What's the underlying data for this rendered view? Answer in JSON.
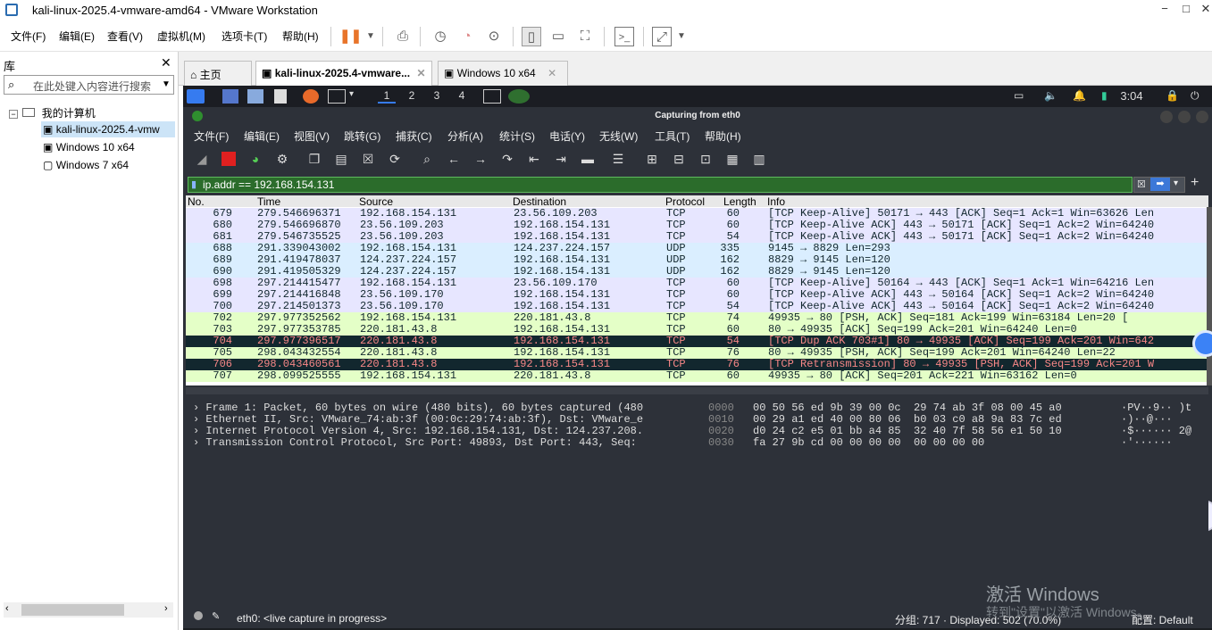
{
  "window": {
    "title": "kali-linux-2025.4-vmware-amd64 - VMware Workstation",
    "min": "−",
    "max": "□",
    "close": "✕"
  },
  "menu": [
    "文件(F)",
    "编辑(E)",
    "查看(V)",
    "虚拟机(M)",
    "选项卡(T)",
    "帮助(H)"
  ],
  "library": {
    "title": "库",
    "close": "✕",
    "search_placeholder": "在此处键入内容进行搜索",
    "root": "我的计算机",
    "vms": [
      "kali-linux-2025.4-vmw",
      "Windows 10 x64",
      "Windows 7 x64"
    ]
  },
  "tabs": [
    {
      "label": "主页"
    },
    {
      "label": "kali-linux-2025.4-vmware..."
    },
    {
      "label": "Windows 10 x64"
    }
  ],
  "kali_panel": {
    "workspaces": [
      "1",
      "2",
      "3",
      "4"
    ],
    "time": "3:04"
  },
  "wireshark": {
    "title": "Capturing from eth0",
    "menu": [
      "文件(F)",
      "编辑(E)",
      "视图(V)",
      "跳转(G)",
      "捕获(C)",
      "分析(A)",
      "统计(S)",
      "电话(Y)",
      "无线(W)",
      "工具(T)",
      "帮助(H)"
    ],
    "filter": "ip.addr == 192.168.154.131",
    "columns": [
      "No.",
      "Time",
      "Source",
      "Destination",
      "Protocol",
      "Length",
      "Info"
    ],
    "packets": [
      {
        "no": "679",
        "time": "279.546696371",
        "src": "192.168.154.131",
        "dst": "23.56.109.203",
        "proto": "TCP",
        "len": "60",
        "info": "[TCP Keep-Alive] 50171 → 443 [ACK] Seq=1 Ack=1 Win=63626 Len",
        "bg": "#e7e6ff",
        "fg": "#12272e"
      },
      {
        "no": "680",
        "time": "279.546696870",
        "src": "23.56.109.203",
        "dst": "192.168.154.131",
        "proto": "TCP",
        "len": "60",
        "info": "[TCP Keep-Alive ACK] 443 → 50171 [ACK] Seq=1 Ack=2 Win=64240",
        "bg": "#e7e6ff",
        "fg": "#12272e"
      },
      {
        "no": "681",
        "time": "279.546735525",
        "src": "23.56.109.203",
        "dst": "192.168.154.131",
        "proto": "TCP",
        "len": "54",
        "info": "[TCP Keep-Alive ACK] 443 → 50171 [ACK] Seq=1 Ack=2 Win=64240",
        "bg": "#e7e6ff",
        "fg": "#12272e"
      },
      {
        "no": "688",
        "time": "291.339043002",
        "src": "192.168.154.131",
        "dst": "124.237.224.157",
        "proto": "UDP",
        "len": "335",
        "info": "9145 → 8829 Len=293",
        "bg": "#daeeff",
        "fg": "#12272e"
      },
      {
        "no": "689",
        "time": "291.419478037",
        "src": "124.237.224.157",
        "dst": "192.168.154.131",
        "proto": "UDP",
        "len": "162",
        "info": "8829 → 9145 Len=120",
        "bg": "#daeeff",
        "fg": "#12272e"
      },
      {
        "no": "690",
        "time": "291.419505329",
        "src": "124.237.224.157",
        "dst": "192.168.154.131",
        "proto": "UDP",
        "len": "162",
        "info": "8829 → 9145 Len=120",
        "bg": "#daeeff",
        "fg": "#12272e"
      },
      {
        "no": "698",
        "time": "297.214415477",
        "src": "192.168.154.131",
        "dst": "23.56.109.170",
        "proto": "TCP",
        "len": "60",
        "info": "[TCP Keep-Alive] 50164 → 443 [ACK] Seq=1 Ack=1 Win=64216 Len",
        "bg": "#e7e6ff",
        "fg": "#12272e"
      },
      {
        "no": "699",
        "time": "297.214416848",
        "src": "23.56.109.170",
        "dst": "192.168.154.131",
        "proto": "TCP",
        "len": "60",
        "info": "[TCP Keep-Alive ACK] 443 → 50164 [ACK] Seq=1 Ack=2 Win=64240",
        "bg": "#e7e6ff",
        "fg": "#12272e"
      },
      {
        "no": "700",
        "time": "297.214501373",
        "src": "23.56.109.170",
        "dst": "192.168.154.131",
        "proto": "TCP",
        "len": "54",
        "info": "[TCP Keep-Alive ACK] 443 → 50164 [ACK] Seq=1 Ack=2 Win=64240",
        "bg": "#e7e6ff",
        "fg": "#12272e"
      },
      {
        "no": "702",
        "time": "297.977352562",
        "src": "192.168.154.131",
        "dst": "220.181.43.8",
        "proto": "TCP",
        "len": "74",
        "info": "49935 → 80 [PSH, ACK] Seq=181 Ack=199 Win=63184 Len=20 [",
        "bg": "#e4ffc7",
        "fg": "#12272e"
      },
      {
        "no": "703",
        "time": "297.977353785",
        "src": "220.181.43.8",
        "dst": "192.168.154.131",
        "proto": "TCP",
        "len": "60",
        "info": "80 → 49935 [ACK] Seq=199 Ack=201 Win=64240 Len=0",
        "bg": "#e4ffc7",
        "fg": "#12272e"
      },
      {
        "no": "704",
        "time": "297.977396517",
        "src": "220.181.43.8",
        "dst": "192.168.154.131",
        "proto": "TCP",
        "len": "54",
        "info": "[TCP Dup ACK 703#1] 80 → 49935 [ACK] Seq=199 Ack=201 Win=642",
        "bg": "#12272e",
        "fg": "#f78787"
      },
      {
        "no": "705",
        "time": "298.043432554",
        "src": "220.181.43.8",
        "dst": "192.168.154.131",
        "proto": "TCP",
        "len": "76",
        "info": "80 → 49935 [PSH, ACK] Seq=199 Ack=201 Win=64240 Len=22",
        "bg": "#e4ffc7",
        "fg": "#12272e"
      },
      {
        "no": "706",
        "time": "298.043460561",
        "src": "220.181.43.8",
        "dst": "192.168.154.131",
        "proto": "TCP",
        "len": "76",
        "info": "[TCP Retransmission] 80 → 49935 [PSH, ACK] Seq=199 Ack=201 W",
        "bg": "#12272e",
        "fg": "#f78787"
      },
      {
        "no": "707",
        "time": "298.099525555",
        "src": "192.168.154.131",
        "dst": "220.181.43.8",
        "proto": "TCP",
        "len": "60",
        "info": "49935 → 80 [ACK] Seq=201 Ack=221 Win=63162 Len=0",
        "bg": "#e4ffc7",
        "fg": "#12272e"
      }
    ],
    "details": [
      "Frame 1: Packet, 60 bytes on wire (480 bits), 60 bytes captured (480",
      "Ethernet II, Src: VMware_74:ab:3f (00:0c:29:74:ab:3f), Dst: VMware_e",
      "Internet Protocol Version 4, Src: 192.168.154.131, Dst: 124.237.208.",
      "Transmission Control Protocol, Src Port: 49893, Dst Port: 443, Seq:"
    ],
    "hex": [
      {
        "off": "0000",
        "bytes": "00 50 56 ed 9b 39 00 0c  29 74 ab 3f 08 00 45 a0",
        "ascii": "·PV··9·· )t"
      },
      {
        "off": "0010",
        "bytes": "00 29 a1 ed 40 00 80 06  b0 03 c0 a8 9a 83 7c ed",
        "ascii": "·)··@···"
      },
      {
        "off": "0020",
        "bytes": "d0 24 c2 e5 01 bb a4 85  32 40 7f 58 56 e1 50 10",
        "ascii": "·$······ 2@"
      },
      {
        "off": "0030",
        "bytes": "fa 27 9b cd 00 00 00 00  00 00 00 00",
        "ascii": "·'······"
      }
    ],
    "status_left": "eth0: <live capture in progress>",
    "status_mid": "分组: 717 · Displayed: 502 (70.0%)",
    "status_right": "配置: Default"
  },
  "watermark": {
    "line1": "激活 Windows",
    "line2": "转到\"设置\"以激活 Windows。"
  }
}
